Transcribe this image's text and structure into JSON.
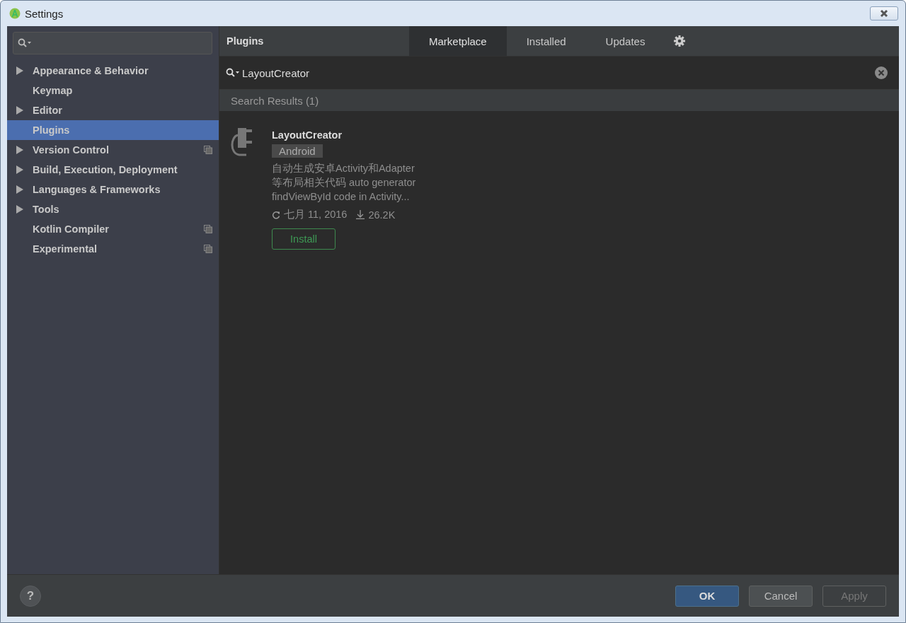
{
  "window": {
    "title": "Settings"
  },
  "sidebar": {
    "items": [
      {
        "label": "Appearance & Behavior",
        "expandable": true,
        "selected": false,
        "project_scoped": false
      },
      {
        "label": "Keymap",
        "expandable": false,
        "selected": false,
        "project_scoped": false
      },
      {
        "label": "Editor",
        "expandable": true,
        "selected": false,
        "project_scoped": false
      },
      {
        "label": "Plugins",
        "expandable": false,
        "selected": true,
        "project_scoped": false
      },
      {
        "label": "Version Control",
        "expandable": true,
        "selected": false,
        "project_scoped": true
      },
      {
        "label": "Build, Execution, Deployment",
        "expandable": true,
        "selected": false,
        "project_scoped": false
      },
      {
        "label": "Languages & Frameworks",
        "expandable": true,
        "selected": false,
        "project_scoped": false
      },
      {
        "label": "Tools",
        "expandable": true,
        "selected": false,
        "project_scoped": false
      },
      {
        "label": "Kotlin Compiler",
        "expandable": false,
        "selected": false,
        "project_scoped": true
      },
      {
        "label": "Experimental",
        "expandable": false,
        "selected": false,
        "project_scoped": true
      }
    ]
  },
  "header": {
    "title": "Plugins",
    "tabs": [
      {
        "label": "Marketplace",
        "selected": true
      },
      {
        "label": "Installed",
        "selected": false
      },
      {
        "label": "Updates",
        "selected": false
      }
    ]
  },
  "search": {
    "value": "LayoutCreator"
  },
  "results": {
    "heading": "Search Results (1)",
    "plugins": [
      {
        "name": "LayoutCreator",
        "tag": "Android",
        "description": "自动生成安卓Activity和Adapter\n等布局相关代码 auto generator\nfindViewById code in Activity...",
        "date": "七月 11, 2016",
        "downloads": "26.2K",
        "action": "Install"
      }
    ]
  },
  "footer": {
    "help": "?",
    "buttons": [
      {
        "label": "OK",
        "kind": "primary",
        "disabled": false
      },
      {
        "label": "Cancel",
        "kind": "normal",
        "disabled": false
      },
      {
        "label": "Apply",
        "kind": "normal",
        "disabled": true
      }
    ]
  }
}
